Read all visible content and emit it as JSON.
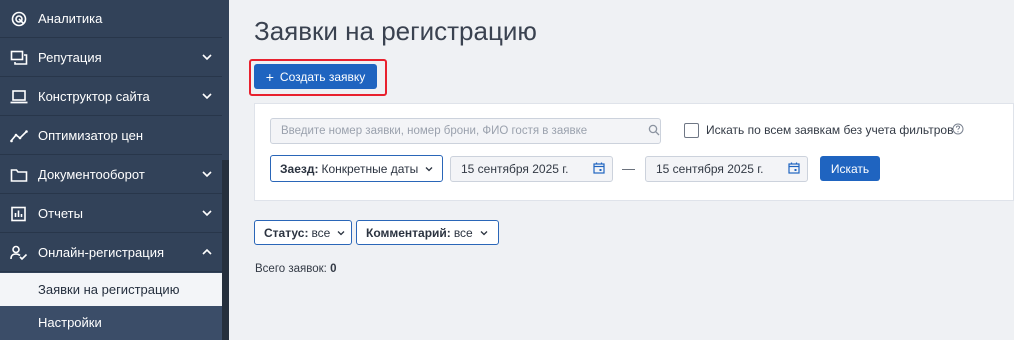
{
  "sidebar": {
    "items": [
      {
        "label": "Аналитика",
        "icon": "analytics-icon"
      },
      {
        "label": "Репутация",
        "icon": "reputation-icon",
        "expandable": true
      },
      {
        "label": "Конструктор сайта",
        "icon": "laptop-icon",
        "expandable": true
      },
      {
        "label": "Оптимизатор цен",
        "icon": "trend-icon"
      },
      {
        "label": "Документооборот",
        "icon": "folder-icon",
        "expandable": true
      },
      {
        "label": "Отчеты",
        "icon": "chart-icon",
        "expandable": true
      },
      {
        "label": "Онлайн-регистрация",
        "icon": "person-check-icon",
        "expanded": true
      }
    ],
    "subitems": [
      {
        "label": "Заявки на регистрацию",
        "active": true
      },
      {
        "label": "Настройки",
        "active": false
      }
    ]
  },
  "page": {
    "title": "Заявки на регистрацию",
    "create_button": "Создать заявку"
  },
  "filters": {
    "search_placeholder": "Введите номер заявки, номер брони, ФИО гостя в заявке",
    "search_value": "",
    "all_requests_label": "Искать по всем заявкам без учета фильтров",
    "all_requests_checked": false,
    "arrival_label": "Заезд:",
    "arrival_value": "Конкретные даты",
    "date_from": "15 сентября 2025 г.",
    "date_separator": "—",
    "date_to": "15 сентября 2025 г.",
    "search_button": "Искать",
    "status_label": "Статус:",
    "status_value": "все",
    "comment_label": "Комментарий:",
    "comment_value": "все"
  },
  "summary": {
    "total_label": "Всего заявок:",
    "total_value": "0"
  },
  "colors": {
    "sidebar_bg": "#324259",
    "primary": "#1f64c0",
    "highlight": "#e8212e"
  }
}
